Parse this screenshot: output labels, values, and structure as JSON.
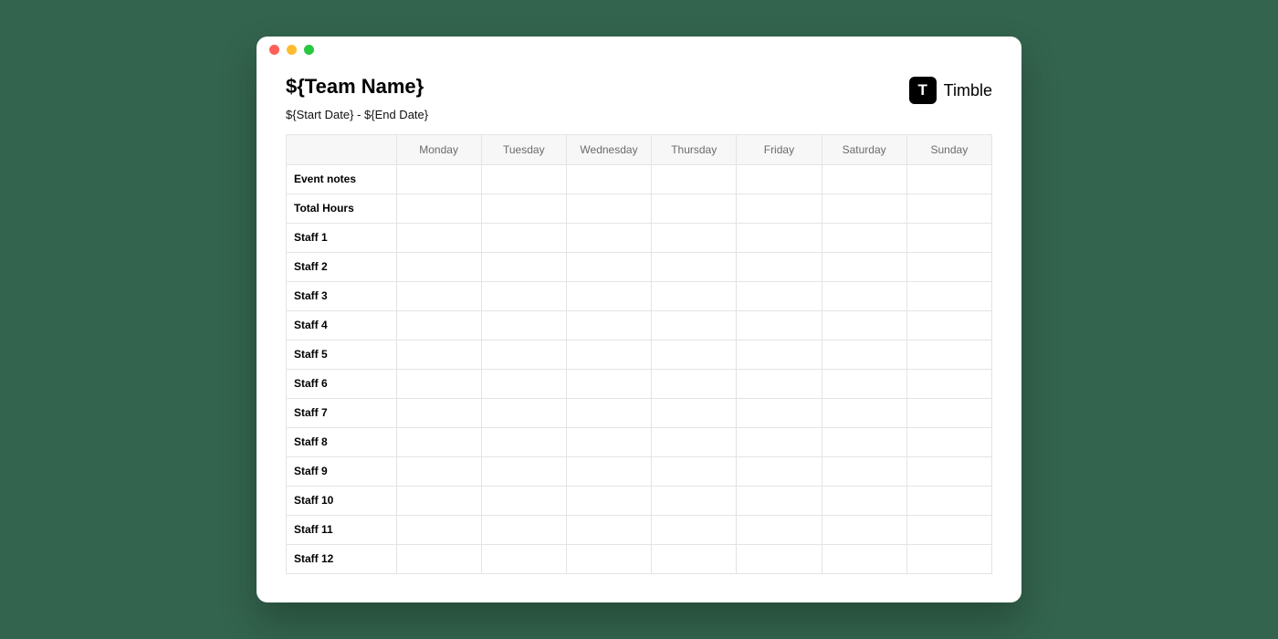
{
  "window": {
    "traffic_light_colors": {
      "red": "#fe5f57",
      "yellow": "#febc2e",
      "green": "#28c840"
    }
  },
  "header": {
    "title": "${Team Name}",
    "date_range": "${Start Date} - ${End Date}"
  },
  "brand": {
    "badge_letter": "T",
    "name": "Timble"
  },
  "schedule": {
    "columns": [
      "Monday",
      "Tuesday",
      "Wednesday",
      "Thursday",
      "Friday",
      "Saturday",
      "Sunday"
    ],
    "rows": [
      {
        "label": "Event notes",
        "cells": [
          "",
          "",
          "",
          "",
          "",
          "",
          ""
        ]
      },
      {
        "label": "Total Hours",
        "cells": [
          "",
          "",
          "",
          "",
          "",
          "",
          ""
        ]
      },
      {
        "label": "Staff 1",
        "cells": [
          "",
          "",
          "",
          "",
          "",
          "",
          ""
        ]
      },
      {
        "label": "Staff 2",
        "cells": [
          "",
          "",
          "",
          "",
          "",
          "",
          ""
        ]
      },
      {
        "label": "Staff 3",
        "cells": [
          "",
          "",
          "",
          "",
          "",
          "",
          ""
        ]
      },
      {
        "label": "Staff 4",
        "cells": [
          "",
          "",
          "",
          "",
          "",
          "",
          ""
        ]
      },
      {
        "label": "Staff 5",
        "cells": [
          "",
          "",
          "",
          "",
          "",
          "",
          ""
        ]
      },
      {
        "label": "Staff 6",
        "cells": [
          "",
          "",
          "",
          "",
          "",
          "",
          ""
        ]
      },
      {
        "label": "Staff 7",
        "cells": [
          "",
          "",
          "",
          "",
          "",
          "",
          ""
        ]
      },
      {
        "label": "Staff 8",
        "cells": [
          "",
          "",
          "",
          "",
          "",
          "",
          ""
        ]
      },
      {
        "label": "Staff 9",
        "cells": [
          "",
          "",
          "",
          "",
          "",
          "",
          ""
        ]
      },
      {
        "label": "Staff 10",
        "cells": [
          "",
          "",
          "",
          "",
          "",
          "",
          ""
        ]
      },
      {
        "label": "Staff 11",
        "cells": [
          "",
          "",
          "",
          "",
          "",
          "",
          ""
        ]
      },
      {
        "label": "Staff 12",
        "cells": [
          "",
          "",
          "",
          "",
          "",
          "",
          ""
        ]
      }
    ]
  }
}
